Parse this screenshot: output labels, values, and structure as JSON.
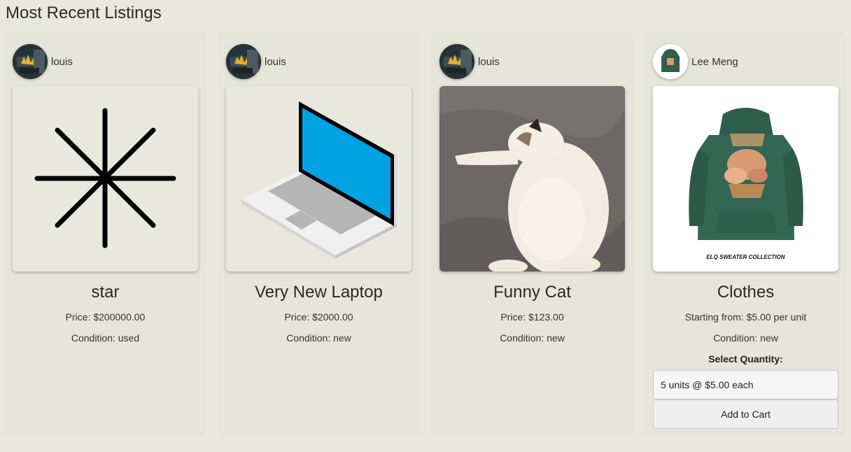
{
  "page": {
    "title": "Most Recent Listings"
  },
  "listings": [
    {
      "seller": "louis",
      "title": "star",
      "price": "Price: $200000.00",
      "condition": "Condition: used"
    },
    {
      "seller": "louis",
      "title": "Very New Laptop",
      "price": "Price: $2000.00",
      "condition": "Condition: new"
    },
    {
      "seller": "louis",
      "title": "Funny Cat",
      "price": "Price: $123.00",
      "condition": "Condition: new"
    },
    {
      "seller": "Lee Meng",
      "title": "Clothes",
      "price": "Starting from: $5.00 per unit",
      "condition": "Condition: new",
      "quantity_label": "Select Quantity:",
      "quantity_selected": "5 units @ $5.00 each",
      "add_to_cart_label": "Add to Cart",
      "image_caption": "ELQ SWEATER COLLECTION"
    }
  ]
}
